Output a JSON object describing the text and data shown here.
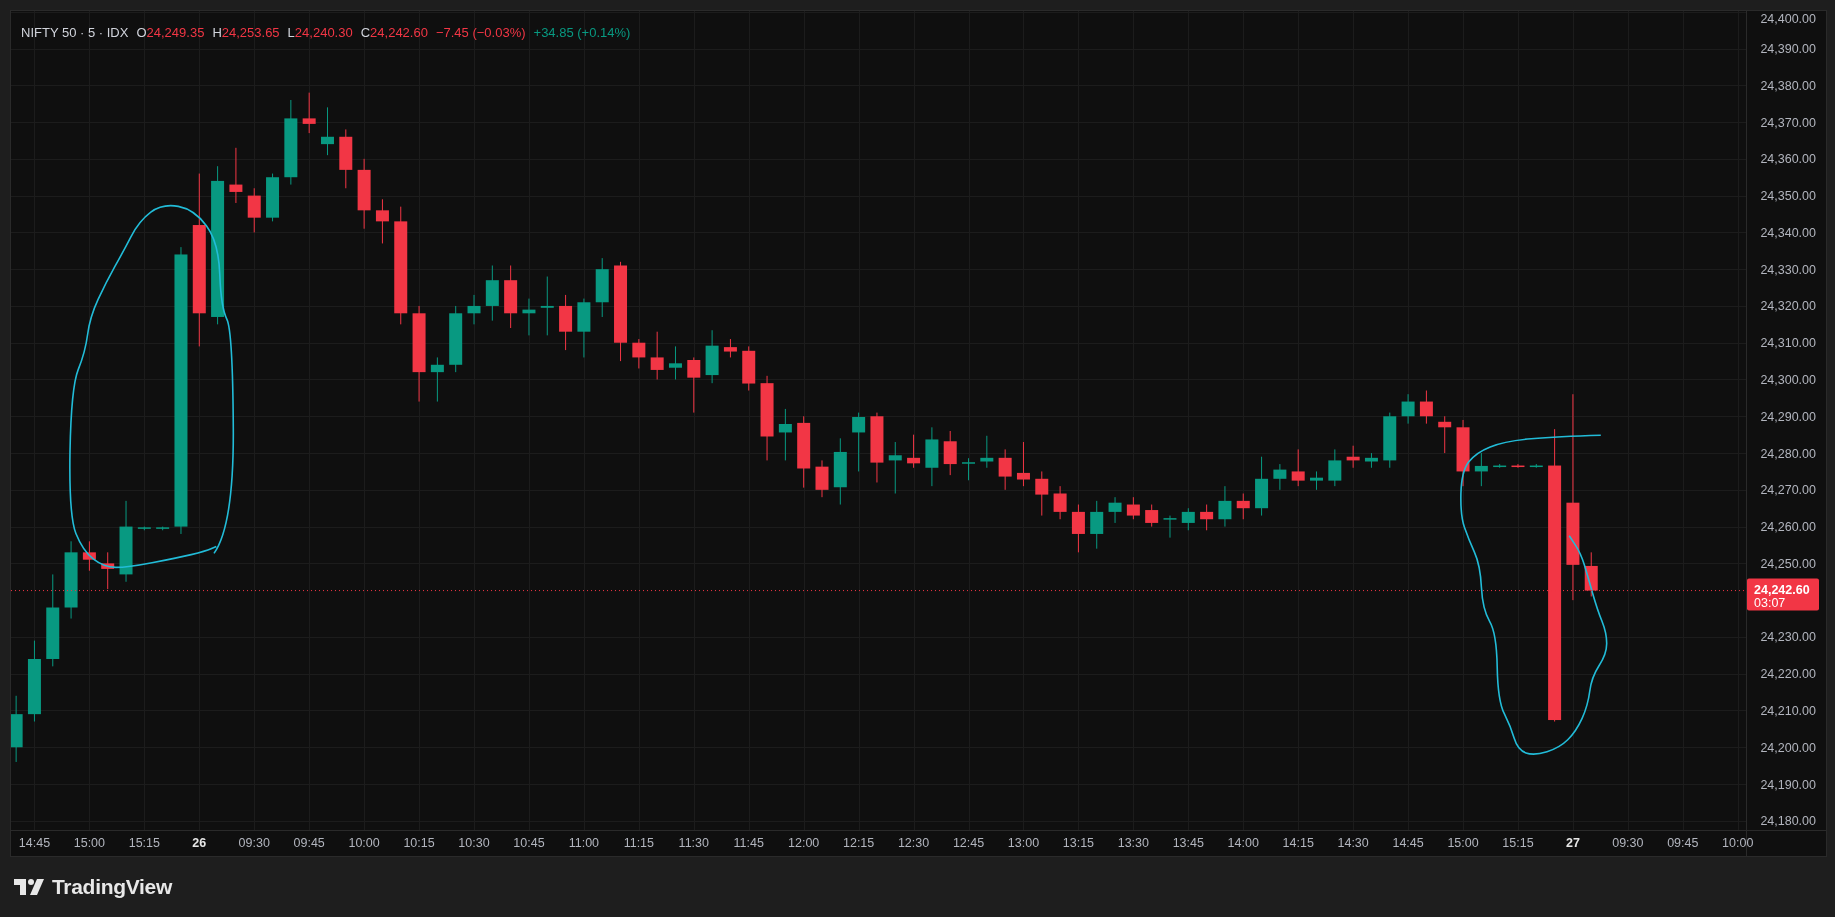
{
  "legend": {
    "symbol": "NIFTY 50 · 5 · IDX",
    "ohlc": [
      {
        "label": "O",
        "value": "24,249.35",
        "color": "#f23645"
      },
      {
        "label": "H",
        "value": "24,253.65",
        "color": "#f23645"
      },
      {
        "label": "L",
        "value": "24,240.30",
        "color": "#f23645"
      },
      {
        "label": "C",
        "value": "24,242.60",
        "color": "#f23645"
      }
    ],
    "changes": [
      {
        "text": "−7.45 (−0.03%)",
        "color": "#f23645"
      },
      {
        "text": "+34.85 (+0.14%)",
        "color": "#089981"
      }
    ]
  },
  "price_axis": {
    "labels": [
      "24,400.00",
      "24,390.00",
      "24,380.00",
      "24,370.00",
      "24,360.00",
      "24,350.00",
      "24,340.00",
      "24,330.00",
      "24,320.00",
      "24,310.00",
      "24,300.00",
      "24,290.00",
      "24,280.00",
      "24,270.00",
      "24,260.00",
      "24,250.00",
      "24,230.00",
      "24,220.00",
      "24,210.00",
      "24,200.00",
      "24,190.00",
      "24,180.00"
    ]
  },
  "time_axis": {
    "labels": [
      {
        "text": "14:45",
        "kind": "time"
      },
      {
        "text": "15:00",
        "kind": "time"
      },
      {
        "text": "15:15",
        "kind": "time"
      },
      {
        "text": "26",
        "kind": "date"
      },
      {
        "text": "09:30",
        "kind": "time"
      },
      {
        "text": "09:45",
        "kind": "time"
      },
      {
        "text": "10:00",
        "kind": "time"
      },
      {
        "text": "10:15",
        "kind": "time"
      },
      {
        "text": "10:30",
        "kind": "time"
      },
      {
        "text": "10:45",
        "kind": "time"
      },
      {
        "text": "11:00",
        "kind": "time"
      },
      {
        "text": "11:15",
        "kind": "time"
      },
      {
        "text": "11:30",
        "kind": "time"
      },
      {
        "text": "11:45",
        "kind": "time"
      },
      {
        "text": "12:00",
        "kind": "time"
      },
      {
        "text": "12:15",
        "kind": "time"
      },
      {
        "text": "12:30",
        "kind": "time"
      },
      {
        "text": "12:45",
        "kind": "time"
      },
      {
        "text": "13:00",
        "kind": "time"
      },
      {
        "text": "13:15",
        "kind": "time"
      },
      {
        "text": "13:30",
        "kind": "time"
      },
      {
        "text": "13:45",
        "kind": "time"
      },
      {
        "text": "14:00",
        "kind": "time"
      },
      {
        "text": "14:15",
        "kind": "time"
      },
      {
        "text": "14:30",
        "kind": "time"
      },
      {
        "text": "14:45",
        "kind": "time"
      },
      {
        "text": "15:00",
        "kind": "time"
      },
      {
        "text": "15:15",
        "kind": "time"
      },
      {
        "text": "27",
        "kind": "date"
      },
      {
        "text": "09:30",
        "kind": "time"
      },
      {
        "text": "09:45",
        "kind": "time"
      },
      {
        "text": "10:00",
        "kind": "time"
      }
    ]
  },
  "last_price": {
    "price": "24,242.60",
    "countdown": "03:07"
  },
  "footer": {
    "brand": "TradingView"
  }
}
